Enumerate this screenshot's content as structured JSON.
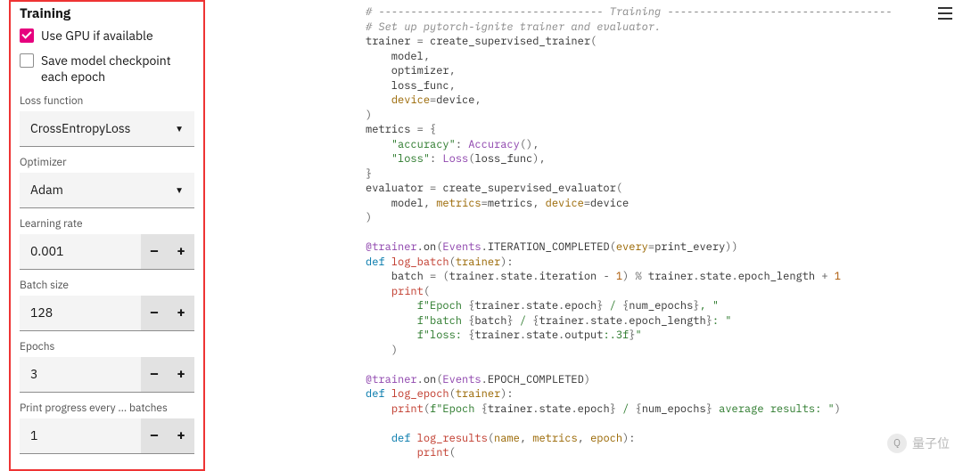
{
  "sidebar": {
    "title": "Training",
    "checkboxes": [
      {
        "label": "Use GPU if available",
        "checked": true
      },
      {
        "label": "Save model checkpoint each epoch",
        "checked": false
      }
    ],
    "fields": {
      "loss_function": {
        "label": "Loss function",
        "value": "CrossEntropyLoss"
      },
      "optimizer": {
        "label": "Optimizer",
        "value": "Adam"
      },
      "learning_rate": {
        "label": "Learning rate",
        "value": "0.001"
      },
      "batch_size": {
        "label": "Batch size",
        "value": "128"
      },
      "epochs": {
        "label": "Epochs",
        "value": "3"
      },
      "print_every": {
        "label": "Print progress every ... batches",
        "value": "1"
      }
    },
    "stepper_minus": "–",
    "stepper_plus": "+"
  },
  "code": {
    "c01": "# ----------------------------------- Training -----------------------------------",
    "c02": "# Set up pytorch-ignite trainer and evaluator.",
    "l03a": "trainer ",
    "l03b": " create_supervised_trainer",
    "l04": "    model",
    "l05": "    optimizer",
    "l06": "    loss_func",
    "l07a": "    ",
    "l07k": "device",
    "l07b": "device",
    "l09a": "metrics ",
    "l10a": "    ",
    "l10s": "\"accuracy\"",
    "l10b": " Accuracy",
    "l11a": "    ",
    "l11s": "\"loss\"",
    "l11b": " Loss",
    "l11c": "loss_func",
    "l13a": "evaluator ",
    "l13b": " create_supervised_evaluator",
    "l14a": "    model",
    "l14k1": "metrics",
    "l14v1": "metrics",
    "l14k2": "device",
    "l14v2": "device",
    "l16d": "@trainer",
    "l16a": "on",
    "l16b": "Events",
    "l16c": "ITERATION_COMPLETED",
    "l16k": "every",
    "l16v": "print_every",
    "l17kw": "def",
    "l17fn": "log_batch",
    "l17arg": "trainer",
    "l18a": "    batch ",
    "l18b": "trainer",
    "l18c": "state",
    "l18d": "iteration",
    "l18n1": "1",
    "l18e": " trainer",
    "l18f": "state",
    "l18g": "epoch_length",
    "l18n2": "1",
    "l19a": "    ",
    "l19fn": "print",
    "l20a": "        ",
    "l20s1": "f\"Epoch ",
    "l20b": "trainer",
    "l20c": "state",
    "l20d": "epoch",
    "l20s2": " / ",
    "l20e": "num_epochs",
    "l20s3": ", \"",
    "l21a": "        ",
    "l21s1": "f\"batch ",
    "l21b": "batch",
    "l21s2": " / ",
    "l21c": "trainer",
    "l21d": "state",
    "l21e": "epoch_length",
    "l21s3": ": \"",
    "l22a": "        ",
    "l22s1": "f\"loss: ",
    "l22b": "trainer",
    "l22c": "state",
    "l22d": "output",
    "l22s2": ":.3f",
    "l22s3": "\"",
    "l24d": "@trainer",
    "l24a": "on",
    "l24b": "Events",
    "l24c": "EPOCH_COMPLETED",
    "l25kw": "def",
    "l25fn": "log_epoch",
    "l25arg": "trainer",
    "l26a": "    ",
    "l26fn": "print",
    "l26s1": "f\"Epoch ",
    "l26b": "trainer",
    "l26c": "state",
    "l26d": "epoch",
    "l26s2": " / ",
    "l26e": "num_epochs",
    "l26s3": " average results: \"",
    "l28kw": "def",
    "l28fn": "log_results",
    "l28a1": "name",
    "l28a2": "metrics",
    "l28a3": "epoch",
    "l29a": "        ",
    "l29fn": "print"
  },
  "watermark": {
    "text": "量子位"
  }
}
